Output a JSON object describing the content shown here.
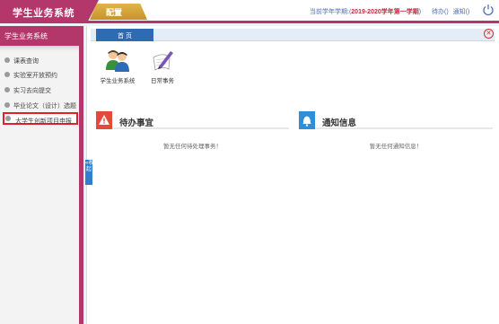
{
  "header": {
    "brand": "学生业务系统",
    "config_tab": "配置",
    "term_prefix": "当前学年学期:(",
    "term_value": "2019-2020学年第一学期",
    "term_suffix": ")",
    "links": {
      "todo": "待办()",
      "notice": "通知()"
    },
    "accent": "#b3376a"
  },
  "sidebar": {
    "title": "学生业务系统",
    "items": [
      {
        "label": "课表查询"
      },
      {
        "label": "实验室开放预约"
      },
      {
        "label": "实习去向提交"
      },
      {
        "label": "毕业论文（设计）选题"
      },
      {
        "label": "大学生创新项目申报",
        "active": true
      }
    ],
    "collapse_label": "«收起"
  },
  "main": {
    "home_tab": "首 页",
    "apps": [
      {
        "label": "学生业务系统",
        "icon": "users-icon"
      },
      {
        "label": "日常事务",
        "icon": "pen-icon"
      }
    ],
    "todo_panel": {
      "title": "待办事宜",
      "empty": "暂无任何待处理事务！",
      "color": "#e34a3c"
    },
    "notice_panel": {
      "title": "通知信息",
      "empty": "暂无任何通知信息！",
      "color": "#2e8fd6"
    }
  }
}
